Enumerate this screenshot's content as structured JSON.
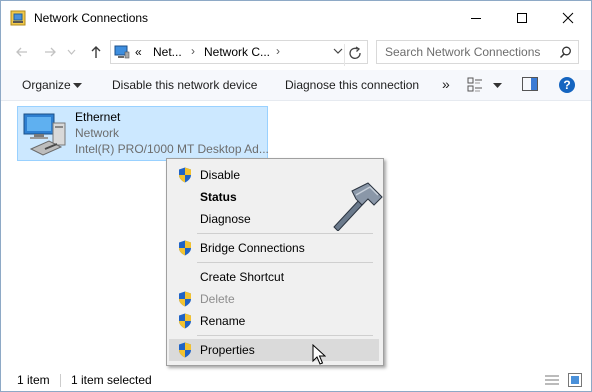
{
  "window": {
    "title": "Network Connections"
  },
  "address": {
    "breadcrumb": [
      "«",
      "Net...",
      "Network C..."
    ]
  },
  "search": {
    "placeholder": "Search Network Connections"
  },
  "commandbar": {
    "organize": "Organize",
    "disable_device": "Disable this network device",
    "diagnose": "Diagnose this connection",
    "more": "»"
  },
  "item": {
    "name": "Ethernet",
    "type": "Network",
    "description": "Intel(R) PRO/1000 MT Desktop Ad..."
  },
  "context_menu": {
    "items": [
      {
        "label": "Disable"
      },
      {
        "label": "Status"
      },
      {
        "label": "Diagnose"
      },
      {
        "label": "Bridge Connections"
      },
      {
        "label": "Create Shortcut"
      },
      {
        "label": "Delete"
      },
      {
        "label": "Rename"
      },
      {
        "label": "Properties"
      }
    ]
  },
  "statusbar": {
    "count": "1 item",
    "selected": "1 item selected"
  },
  "icons": [
    "network-connections-icon",
    "minimize-icon",
    "maximize-icon",
    "close-icon",
    "back-icon",
    "forward-icon",
    "up-arrow-icon",
    "computer-icon",
    "chevron-right-icon",
    "refresh-icon",
    "search-icon",
    "dropdown-caret-icon",
    "view-options-icon",
    "preview-pane-icon",
    "help-icon",
    "ethernet-adapter-icon",
    "uac-shield-icon",
    "hammer-logo-icon",
    "mouse-pointer-icon",
    "details-view-icon",
    "large-icons-view-icon"
  ],
  "colors": {
    "selection": "#cce8ff",
    "selection_border": "#99d1ff",
    "menu_bg": "#f0f0f0",
    "help": "#1565c0"
  }
}
